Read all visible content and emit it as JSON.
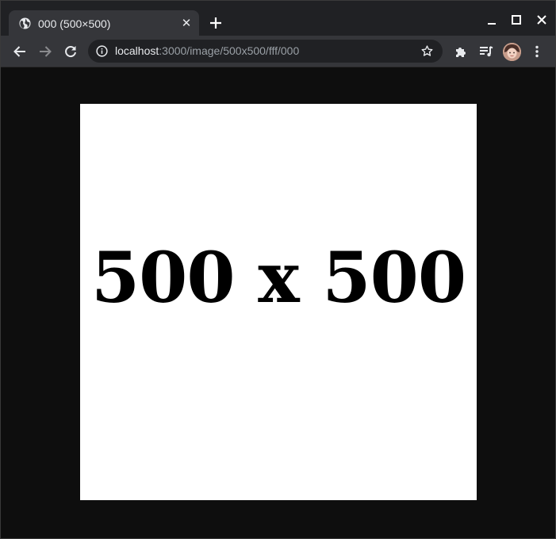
{
  "tab": {
    "title": "000 (500×500)",
    "favicon": "globe-icon",
    "close": "✕"
  },
  "toolbar": {
    "url_host": "localhost",
    "url_path": ":3000/image/500x500/fff/000"
  },
  "image": {
    "label": "500 x 500",
    "background": "#ffffff",
    "text_color": "#000000"
  },
  "colors": {
    "tabstrip": "#202124",
    "toolbar": "#35363a",
    "omnibox": "#202124",
    "page_background": "#0e0e0e"
  }
}
